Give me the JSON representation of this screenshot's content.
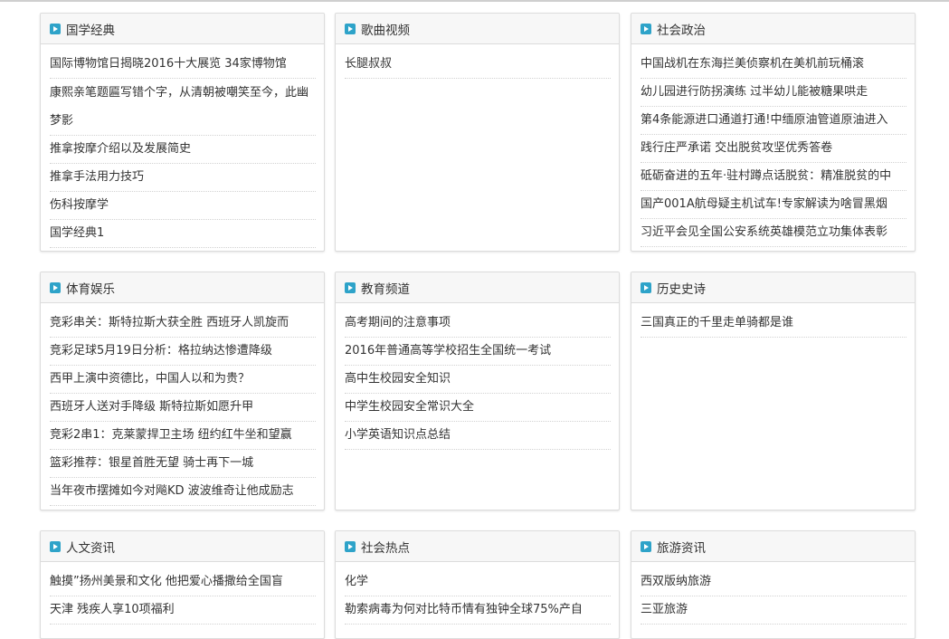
{
  "panels": [
    {
      "title": "国学经典",
      "items": [
        "国际博物馆日揭晓2016十大展览 34家博物馆",
        "康熙亲笔题匾写错个字，从清朝被嘲笑至今，此幽梦影",
        "推拿按摩介绍以及发展简史",
        "推拿手法用力技巧",
        "伤科按摩学",
        "国学经典1"
      ]
    },
    {
      "title": "歌曲视频",
      "items": [
        "长腿叔叔"
      ]
    },
    {
      "title": "社会政治",
      "items": [
        "中国战机在东海拦美侦察机在美机前玩桶滚",
        "幼儿园进行防拐演练 过半幼儿能被糖果哄走",
        "第4条能源进口通道打通!中缅原油管道原油进入",
        "践行庄严承诺 交出脱贫攻坚优秀答卷",
        "砥砺奋进的五年·驻村蹲点话脱贫：精准脱贫的中",
        "国产001A航母疑主机试车!专家解读为啥冒黑烟",
        "习近平会见全国公安系统英雄模范立功集体表彰"
      ]
    },
    {
      "title": "体育娱乐",
      "items": [
        "竞彩串关：斯特拉斯大获全胜 西班牙人凯旋而",
        "竞彩足球5月19日分析：格拉纳达惨遭降级",
        "西甲上演中资德比，中国人以和为贵？",
        "西班牙人送对手降级 斯特拉斯如愿升甲",
        "竞彩2串1：克莱蒙捍卫主场 纽约红牛坐和望赢",
        "篮彩推荐：银星首胜无望 骑士再下一城",
        "当年夜市摆摊如今对飚KD 波波维奇让他成励志"
      ]
    },
    {
      "title": "教育频道",
      "items": [
        "高考期间的注意事项",
        "2016年普通高等学校招生全国统一考试",
        "高中生校园安全知识",
        "中学生校园安全常识大全",
        "小学英语知识点总结"
      ]
    },
    {
      "title": "历史史诗",
      "items": [
        "三国真正的千里走单骑都是谁"
      ]
    },
    {
      "title": "人文资讯",
      "items": [
        "触摸”扬州美景和文化 他把爱心播撒给全国盲",
        "天津 残疾人享10项福利"
      ]
    },
    {
      "title": "社会热点",
      "items": [
        "化学",
        "勒索病毒为何对比特币情有独钟全球75%产自"
      ]
    },
    {
      "title": "旅游资讯",
      "items": [
        "西双版纳旅游",
        "三亚旅游"
      ]
    }
  ]
}
